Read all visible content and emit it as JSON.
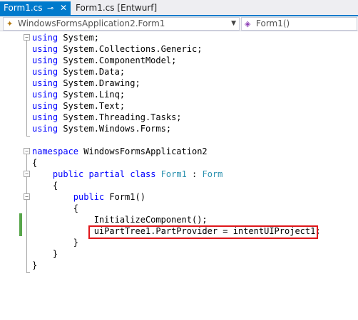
{
  "tabs": {
    "active": {
      "label": "Form1.cs",
      "pin_icon": "pin-icon",
      "close_icon": "close-icon",
      "pin_glyph": "⊸",
      "close_glyph": "✕"
    },
    "second": {
      "label": "Form1.cs [Entwurf]"
    }
  },
  "navigation_bar": {
    "class_combo": {
      "value": "WindowsFormsApplication2.Form1",
      "icon": "class-icon",
      "glyph": "✦"
    },
    "member_combo": {
      "value": "Form1()",
      "icon": "method-icon",
      "glyph": "◈"
    }
  },
  "code": {
    "lines": [
      [
        {
          "t": "using",
          "c": "kw"
        },
        {
          "t": " System;"
        }
      ],
      [
        {
          "t": "using",
          "c": "kw"
        },
        {
          "t": " System.Collections.Generic;"
        }
      ],
      [
        {
          "t": "using",
          "c": "kw"
        },
        {
          "t": " System.ComponentModel;"
        }
      ],
      [
        {
          "t": "using",
          "c": "kw"
        },
        {
          "t": " System.Data;"
        }
      ],
      [
        {
          "t": "using",
          "c": "kw"
        },
        {
          "t": " System.Drawing;"
        }
      ],
      [
        {
          "t": "using",
          "c": "kw"
        },
        {
          "t": " System.Linq;"
        }
      ],
      [
        {
          "t": "using",
          "c": "kw"
        },
        {
          "t": " System.Text;"
        }
      ],
      [
        {
          "t": "using",
          "c": "kw"
        },
        {
          "t": " System.Threading.Tasks;"
        }
      ],
      [
        {
          "t": "using",
          "c": "kw"
        },
        {
          "t": " System.Windows.Forms;"
        }
      ],
      [],
      [
        {
          "t": "namespace",
          "c": "kw"
        },
        {
          "t": " WindowsFormsApplication2"
        }
      ],
      [
        {
          "t": "{"
        }
      ],
      [
        {
          "t": "    "
        },
        {
          "t": "public",
          "c": "kw"
        },
        {
          "t": " "
        },
        {
          "t": "partial",
          "c": "kw"
        },
        {
          "t": " "
        },
        {
          "t": "class",
          "c": "kw"
        },
        {
          "t": " "
        },
        {
          "t": "Form1",
          "c": "ty"
        },
        {
          "t": " : "
        },
        {
          "t": "Form",
          "c": "ty"
        }
      ],
      [
        {
          "t": "    {"
        }
      ],
      [
        {
          "t": "        "
        },
        {
          "t": "public",
          "c": "kw"
        },
        {
          "t": " Form1()"
        }
      ],
      [
        {
          "t": "        {"
        }
      ],
      [
        {
          "t": "            InitializeComponent();"
        }
      ],
      [
        {
          "t": "            uiPartTree1.PartProvider = intentUIProject1;"
        }
      ],
      [
        {
          "t": "        }"
        }
      ],
      [
        {
          "t": "    }"
        }
      ],
      [
        {
          "t": "}"
        }
      ]
    ]
  },
  "colors": {
    "accent": "#007acc",
    "keyword": "#0000ff",
    "type": "#2b91af",
    "change_bar": "#57a64a",
    "highlight_border": "#e0161a"
  }
}
